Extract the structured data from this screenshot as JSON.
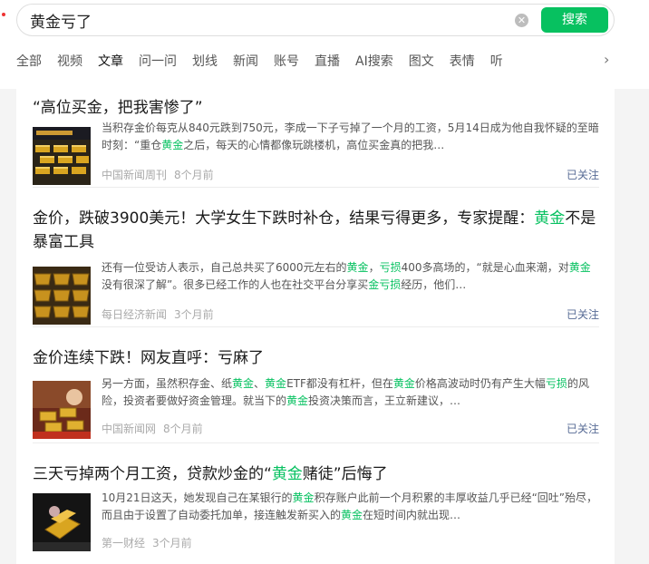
{
  "search": {
    "query": "黄金亏了",
    "button_label": "搜索",
    "clear_icon": "close-circle-icon"
  },
  "tabs": [
    "全部",
    "视频",
    "文章",
    "问一问",
    "划线",
    "新闻",
    "账号",
    "直播",
    "AI搜索",
    "图文",
    "表情",
    "听"
  ],
  "active_tab": "文章",
  "accent_color": "#07c160",
  "articles": [
    {
      "title_parts": [
        {
          "text": "“高位买金，把我害惨了”",
          "hl": false
        }
      ],
      "snippet_parts": [
        {
          "text": "当积存金价每克从840元跌到750元，李成一下子亏掉了一个月的工资，5月14日成为他自我怀疑的至暗时刻：“重仓",
          "hl": false
        },
        {
          "text": "黄金",
          "hl": true
        },
        {
          "text": "之后，每天的心情都像玩跳楼机，高位买金真的把我…",
          "hl": false
        }
      ],
      "source": "中国新闻周刊",
      "time": "8个月前",
      "follow": "已关注"
    },
    {
      "title_parts": [
        {
          "text": "金价，跌破3900美元！大学女生下跌时补仓，结果亏得更多，专家提醒：",
          "hl": false
        },
        {
          "text": "黄金",
          "hl": true
        },
        {
          "text": "不是暴富工具",
          "hl": false
        }
      ],
      "snippet_parts": [
        {
          "text": "还有一位受访人表示，自己总共买了6000元左右的",
          "hl": false
        },
        {
          "text": "黄金",
          "hl": true
        },
        {
          "text": "，",
          "hl": false
        },
        {
          "text": "亏损",
          "hl": true
        },
        {
          "text": "400多高场的，“就是心血来潮，对",
          "hl": false
        },
        {
          "text": "黄金",
          "hl": true
        },
        {
          "text": "没有很深了解”。很多已经工作的人也在社交平台分享买",
          "hl": false
        },
        {
          "text": "金亏损",
          "hl": true
        },
        {
          "text": "经历，他们…",
          "hl": false
        }
      ],
      "source": "每日经济新闻",
      "time": "3个月前",
      "follow": "已关注"
    },
    {
      "title_parts": [
        {
          "text": "金价连续下跌！网友直呼：亏麻了",
          "hl": false
        }
      ],
      "snippet_parts": [
        {
          "text": "另一方面，虽然积存金、纸",
          "hl": false
        },
        {
          "text": "黄金",
          "hl": true
        },
        {
          "text": "、",
          "hl": false
        },
        {
          "text": "黄金",
          "hl": true
        },
        {
          "text": "ETF都没有杠杆，但在",
          "hl": false
        },
        {
          "text": "黄金",
          "hl": true
        },
        {
          "text": "价格高波动时仍有产生大幅",
          "hl": false
        },
        {
          "text": "亏损",
          "hl": true
        },
        {
          "text": "的风险，投资者要做好资金管理。就当下的",
          "hl": false
        },
        {
          "text": "黄金",
          "hl": true
        },
        {
          "text": "投资决策而言，王立新建议，…",
          "hl": false
        }
      ],
      "source": "中国新闻网",
      "time": "8个月前",
      "follow": "已关注"
    },
    {
      "title_parts": [
        {
          "text": "三天亏掉两个月工资，贷款炒金的“",
          "hl": false
        },
        {
          "text": "黄金",
          "hl": true
        },
        {
          "text": "赌徒”后悔了",
          "hl": false
        }
      ],
      "snippet_parts": [
        {
          "text": "10月21日这天，她发现自己在某银行的",
          "hl": false
        },
        {
          "text": "黄金",
          "hl": true
        },
        {
          "text": "积存账户此前一个月积累的丰厚收益几乎已经“回吐”殆尽，而且由于设置了自动委托加单，接连触发新买入的",
          "hl": false
        },
        {
          "text": "黄金",
          "hl": true
        },
        {
          "text": "在短时间内就出现…",
          "hl": false
        }
      ],
      "source": "第一财经",
      "time": "3个月前",
      "follow": ""
    }
  ]
}
